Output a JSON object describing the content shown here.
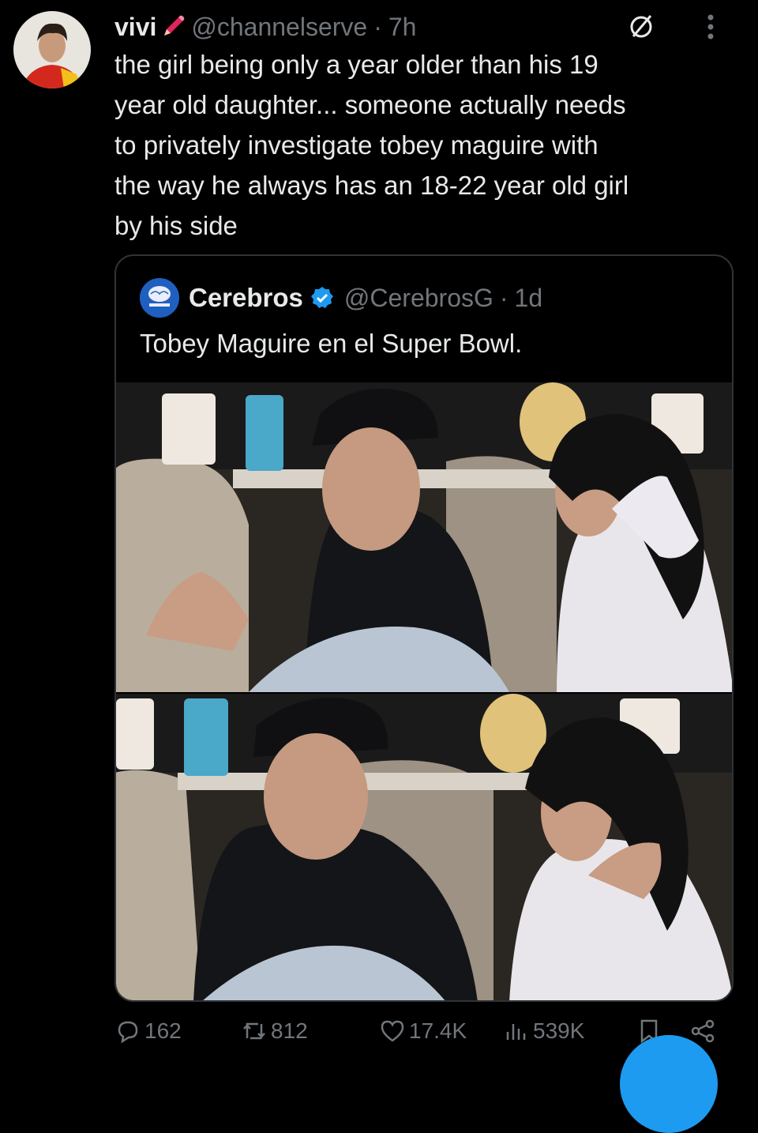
{
  "tweet": {
    "author_name": "vivi",
    "handle": "@channelserve",
    "separator": "·",
    "time": "7h",
    "text": "the girl being only a year older than his 19\nyear old daughter... someone actually needs\nto privately investigate tobey maguire with\nthe way he always has an 18-22 year old girl\nby his side"
  },
  "quoted": {
    "author_name": "Cerebros",
    "handle": "@CerebrosG",
    "separator": "·",
    "time": "1d",
    "text": "Tobey Maguire en el Super Bowl."
  },
  "actions": {
    "replies": "162",
    "reposts": "812",
    "likes": "17.4K",
    "views": "539K"
  },
  "colors": {
    "background": "#000000",
    "text": "#e7e9ea",
    "muted": "#71767b",
    "accent": "#1d9bf0",
    "border": "#2f3336"
  },
  "icons": [
    "pencil-icon",
    "slash-circle-icon",
    "more-icon",
    "verified-icon",
    "reply-icon",
    "repost-icon",
    "like-icon",
    "views-icon",
    "bookmark-icon",
    "share-icon"
  ]
}
